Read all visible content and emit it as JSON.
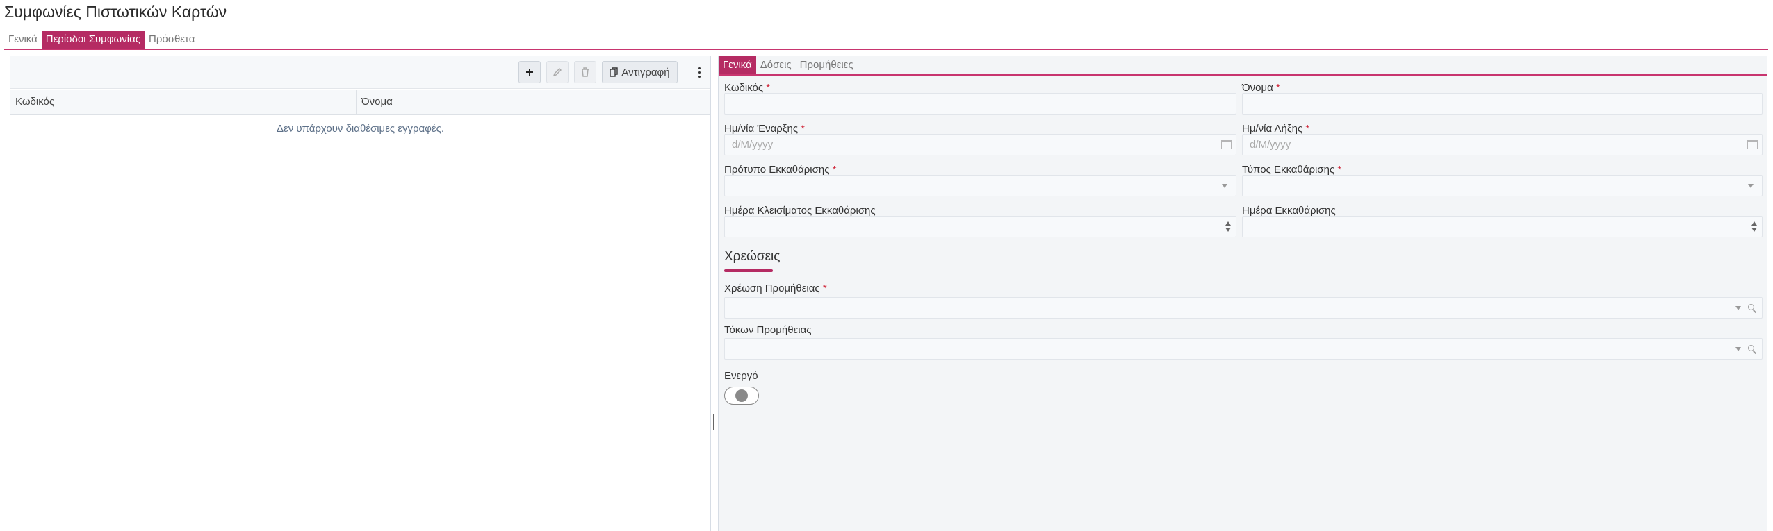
{
  "page": {
    "title": "Συμφωνίες Πιστωτικών Καρτών"
  },
  "main_tabs": [
    {
      "label": "Γενικά",
      "active": false
    },
    {
      "label": "Περίοδοι Συμφωνίας",
      "active": true
    },
    {
      "label": "Πρόσθετα",
      "active": false
    }
  ],
  "toolbar": {
    "add": "add-icon",
    "edit": "pencil-icon",
    "delete": "trash-icon",
    "copy_label": "Αντιγραφή",
    "more": "more-vertical-icon"
  },
  "grid": {
    "columns": [
      "Κωδικός",
      "Όνομα"
    ],
    "empty_message": "Δεν υπάρχουν διαθέσιμες εγγραφές."
  },
  "detail_tabs": [
    {
      "label": "Γενικά",
      "active": true
    },
    {
      "label": "Δόσεις",
      "active": false
    },
    {
      "label": "Προμήθειες",
      "active": false
    }
  ],
  "form": {
    "code_label": "Κωδικός",
    "name_label": "Όνομα",
    "start_date_label": "Ημ/νία Έναρξης",
    "end_date_label": "Ημ/νία Λήξης",
    "date_placeholder": "d/M/yyyy",
    "settlement_template_label": "Πρότυπο Εκκαθάρισης",
    "settlement_type_label": "Τύπος Εκκαθάρισης",
    "closing_day_label": "Ημέρα Κλεισίματος Εκκαθάρισης",
    "settlement_day_label": "Ημέρα Εκκαθάρισης",
    "required_mark": "*"
  },
  "charges": {
    "title": "Χρεώσεις",
    "commission_charge_label": "Χρέωση Προμήθειας",
    "commission_interest_label": "Τόκων Προμήθειας"
  },
  "active": {
    "label": "Ενεργό",
    "value": false
  },
  "colors": {
    "accent": "#b52b63",
    "required": "#d0293c"
  }
}
